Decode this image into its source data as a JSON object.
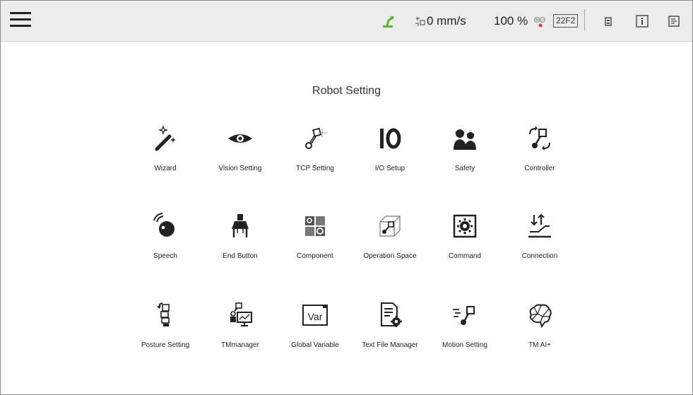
{
  "header": {
    "speed": "0 mm/s",
    "percent": "100 %",
    "code": "22F2",
    "icons": [
      "menu-icon",
      "freedrive-robot-icon",
      "speed-gauge-icon",
      "power-status-icon",
      "battery-icon",
      "info-icon",
      "log-icon"
    ],
    "accent_color": "#5cb335",
    "warning_color": "#e0403a"
  },
  "page": {
    "title": "Robot Setting"
  },
  "tiles": [
    {
      "label": "Wizard",
      "icon": "magic-wand-icon"
    },
    {
      "label": "Vision Setting",
      "icon": "eye-icon"
    },
    {
      "label": "TCP Setting",
      "icon": "tcp-robot-icon"
    },
    {
      "label": "I/O Setup",
      "icon": "io-icon"
    },
    {
      "label": "Safety",
      "icon": "safety-workers-icon"
    },
    {
      "label": "Controller",
      "icon": "controller-icon"
    },
    {
      "label": "Speech",
      "icon": "speech-icon"
    },
    {
      "label": "End Button",
      "icon": "end-button-icon"
    },
    {
      "label": "Component",
      "icon": "component-icon"
    },
    {
      "label": "Operation Space",
      "icon": "operation-space-icon"
    },
    {
      "label": "Command",
      "icon": "command-icon"
    },
    {
      "label": "Connection",
      "icon": "connection-icon"
    },
    {
      "label": "Posture Setting",
      "icon": "posture-icon"
    },
    {
      "label": "TMmanager",
      "icon": "tmmanager-icon"
    },
    {
      "label": "Global Variable",
      "icon": "global-variable-icon",
      "icon_text": "Var"
    },
    {
      "label": "Text File Manager",
      "icon": "text-file-manager-icon"
    },
    {
      "label": "Motion Setting",
      "icon": "motion-setting-icon"
    },
    {
      "label": "TM AI+",
      "icon": "ai-brain-icon"
    }
  ]
}
